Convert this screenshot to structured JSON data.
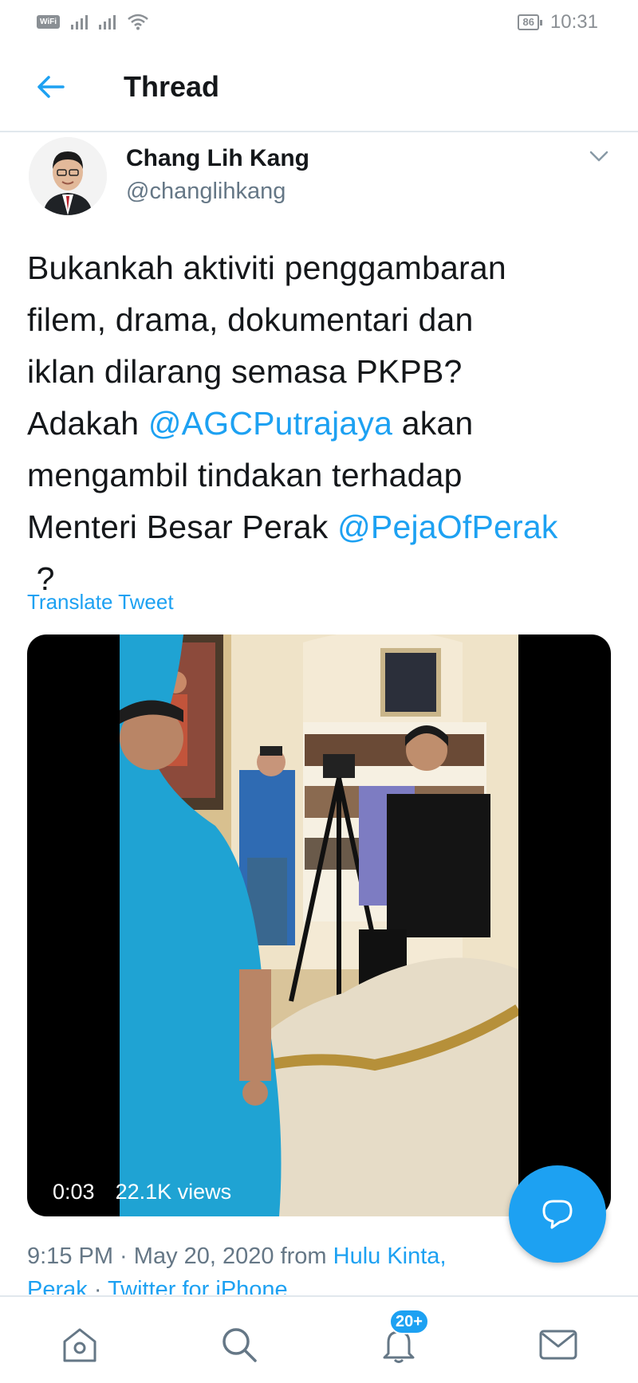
{
  "status_bar": {
    "wifi_label": "WiFi",
    "battery": "86",
    "time": "10:31"
  },
  "header": {
    "title": "Thread",
    "back_icon": "arrow-left-icon"
  },
  "tweet": {
    "author_name": "Chang Lih Kang",
    "author_handle": "@changlihkang",
    "text_lines": [
      "Bukankah aktiviti penggambaran",
      "filem,  drama, dokumentari dan",
      "iklan dilarang semasa PKPB?",
      [
        "Adakah ",
        "@AGCPutrajaya",
        " akan"
      ],
      "mengambil tindakan terhadap",
      [
        "Menteri Besar Perak ",
        "@PejaOfPerak"
      ],
      " ?"
    ],
    "translate_label": "Translate Tweet",
    "video": {
      "duration": "0:03",
      "views": "22.1K views"
    },
    "meta": {
      "time": "9:15 PM",
      "separator": " · ",
      "date": "May 20, 2020",
      "from_label": " from ",
      "location_part1": "Hulu Kinta,",
      "location_part2": "Perak",
      "separator2": " · ",
      "source": "Twitter for iPhone"
    }
  },
  "bottom_nav": {
    "items": [
      "home-icon",
      "search-icon",
      "notifications-icon",
      "messages-icon"
    ],
    "notification_badge": "20+"
  },
  "colors": {
    "accent": "#1da1f2",
    "text": "#14171a",
    "secondary": "#657786"
  }
}
